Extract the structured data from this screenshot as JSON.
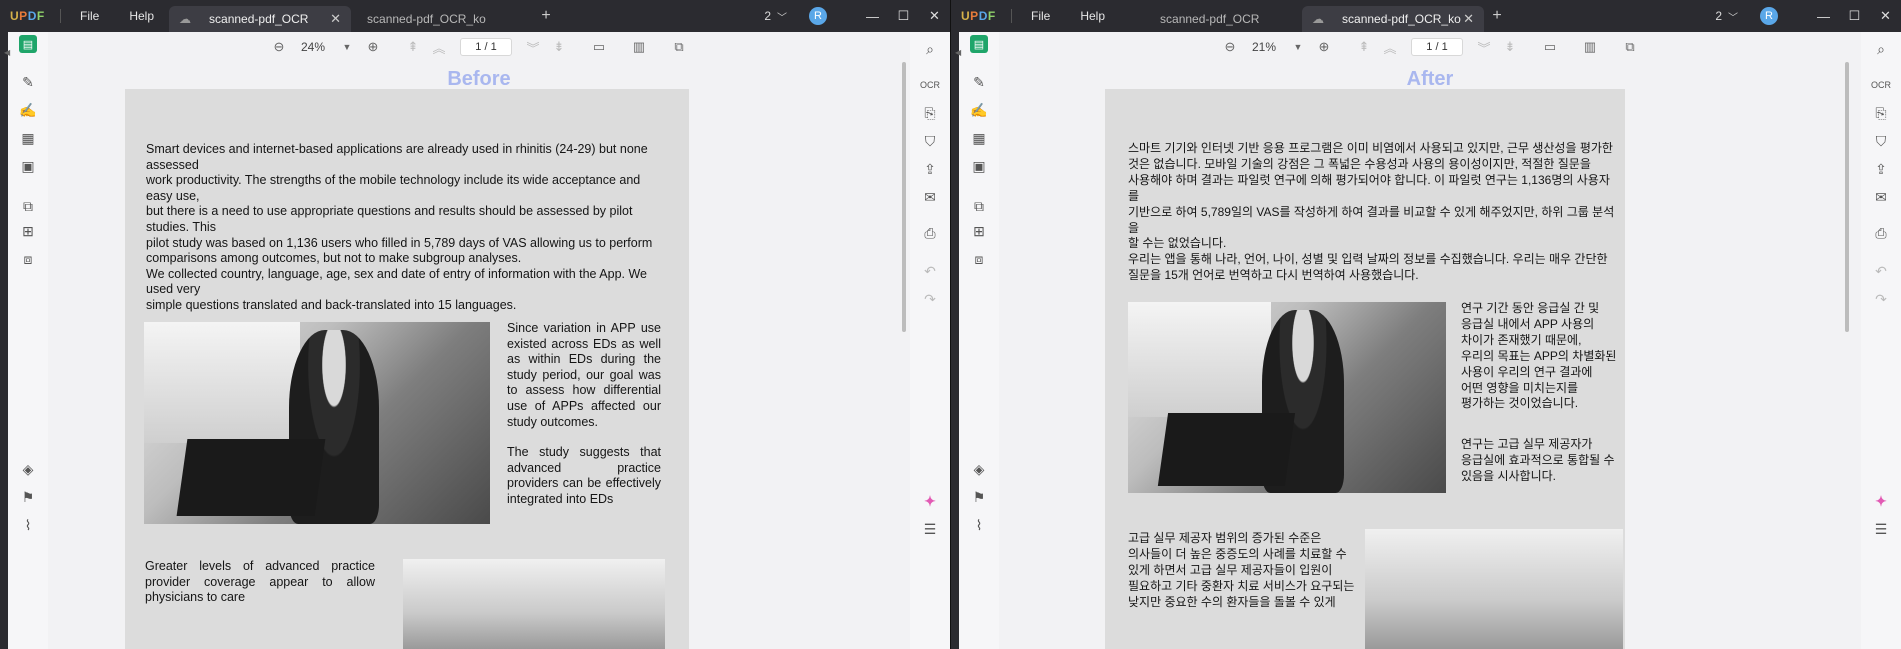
{
  "window": {
    "logo": "UPDF",
    "menu_file": "File",
    "menu_help": "Help",
    "page_count": "2",
    "avatar_letter": "R"
  },
  "left_window": {
    "tabs": [
      {
        "label": "scanned-pdf_OCR",
        "active": true
      },
      {
        "label": "scanned-pdf_OCR_ko",
        "active": false
      }
    ],
    "zoom": "24%",
    "page_indicator": "1 / 1",
    "heading": "Before",
    "doc": {
      "para1_lines": [
        "Smart devices and internet-based applications are already       used in rhinitis (24-29) but none assessed",
        "work productivity. The strengths of the mobile technology include its wide acceptance and easy use,",
        "but there is a need to use appropriate questions and results should be assessed by pilot studies. This",
        "pilot study was based on 1,136 users who filled in 5,789 days of VAS allowing us to perform",
        "comparisons among outcomes, but not to make subgroup analyses.",
        "We collected country, language, age, sex and date of entry of information with the App. We used very",
        "simple questions translated and back-translated into 15 languages."
      ],
      "para2": "Since variation in APP use existed across EDs as well as within EDs during the study period, our goal was to assess how differential use of APPs affected our study outcomes.",
      "para3": "The study suggests that advanced practice providers can be effectively integrated into EDs",
      "para4": "Greater levels of advanced practice provider coverage appear to allow physicians to care"
    }
  },
  "right_window": {
    "tabs": [
      {
        "label": "scanned-pdf_OCR",
        "active": false
      },
      {
        "label": "scanned-pdf_OCR_ko",
        "active": true
      }
    ],
    "zoom": "21%",
    "page_indicator": "1 / 1",
    "heading": "After",
    "doc": {
      "para1_lines": [
        "스마트 기기와 인터넷 기반 응용 프로그램은 이미 비염에서 사용되고 있지만, 근무 생산성을 평가한",
        "것은 없습니다. 모바일 기술의 강점은 그 폭넓은 수용성과 사용의 용이성이지만, 적절한 질문을",
        "사용해야 하며 결과는 파일럿 연구에 의해 평가되어야 합니다. 이 파일럿 연구는 1,136명의 사용자를",
        "기반으로 하여 5,789일의 VAS를 작성하게 하여 결과를 비교할 수 있게 해주었지만, 하위 그룹 분석을",
        "할 수는 없었습니다.",
        "우리는 앱을 통해 나라, 언어, 나이, 성별 및 입력 날짜의 정보를 수집했습니다. 우리는 매우 간단한",
        "질문을 15개 언어로 번역하고 다시 번역하여 사용했습니다."
      ],
      "para2_lines": [
        "연구 기간 동안 응급실 간 및",
        "응급실 내에서 APP 사용의",
        "차이가 존재했기 때문에,",
        "우리의 목표는 APP의 차별화된",
        " 사용이 우리의 연구 결과에",
        "어떤 영향을 미치는지를",
        "평가하는 것이었습니다."
      ],
      "para3_lines": [
        "연구는 고급 실무 제공자가",
        "응급실에 효과적으로 통합될 수",
        " 있음을 시사합니다."
      ],
      "para4_lines": [
        "고급 실무 제공자 범위의 증가된 수준은",
        "의사들이 더 높은 중증도의 사례를 치료할 수",
        "있게 하면서 고급 실무 제공자들이 입원이",
        "필요하고 기타 중환자 치료 서비스가 요구되는",
        " 낮지만 중요한 수의 환자들을 돌볼 수 있게"
      ]
    }
  }
}
